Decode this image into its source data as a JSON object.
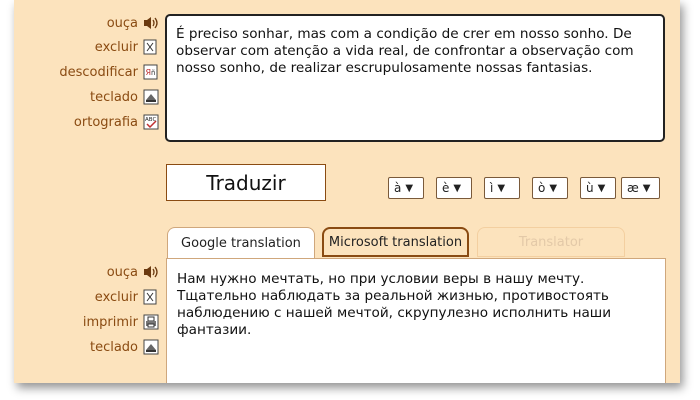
{
  "source_panel": {
    "actions": [
      {
        "label": "ouça",
        "icon": "speaker-icon"
      },
      {
        "label": "excluir",
        "icon": "delete-doc-icon"
      },
      {
        "label": "descodificar",
        "icon": "decode-icon"
      },
      {
        "label": "teclado",
        "icon": "keyboard-icon"
      },
      {
        "label": "ortografia",
        "icon": "spellcheck-icon"
      }
    ],
    "text": "É preciso sonhar, mas com a condição de crer em nosso sonho. De observar com atenção a vida real, de confrontar a observação com nosso sonho, de realizar escrupulosamente nossas fantasias."
  },
  "translate_button": {
    "label": "Traduzir"
  },
  "accent_selects": [
    {
      "value": "à"
    },
    {
      "value": "è"
    },
    {
      "value": "ì"
    },
    {
      "value": "ò"
    },
    {
      "value": "ù"
    },
    {
      "value": "æ"
    }
  ],
  "tabs": [
    {
      "label": "Google translation",
      "state": "active"
    },
    {
      "label": "Microsoft translation",
      "state": "highlighted"
    },
    {
      "label": "Translator",
      "state": "disabled"
    }
  ],
  "result_panel": {
    "actions": [
      {
        "label": "ouça",
        "icon": "speaker-icon"
      },
      {
        "label": "excluir",
        "icon": "delete-doc-icon"
      },
      {
        "label": "imprimir",
        "icon": "print-icon"
      },
      {
        "label": "teclado",
        "icon": "keyboard-icon"
      }
    ],
    "text": "Нам нужно мечтать, но при условии веры в нашу мечту. Тщательно наблюдать за реальной жизнью, противостоять наблюдению с нашей мечтой, скрупулезно исполнить наши фантазии."
  },
  "colors": {
    "background": "#fce3bd",
    "label": "#8a4b12",
    "border_dark": "#222222"
  }
}
